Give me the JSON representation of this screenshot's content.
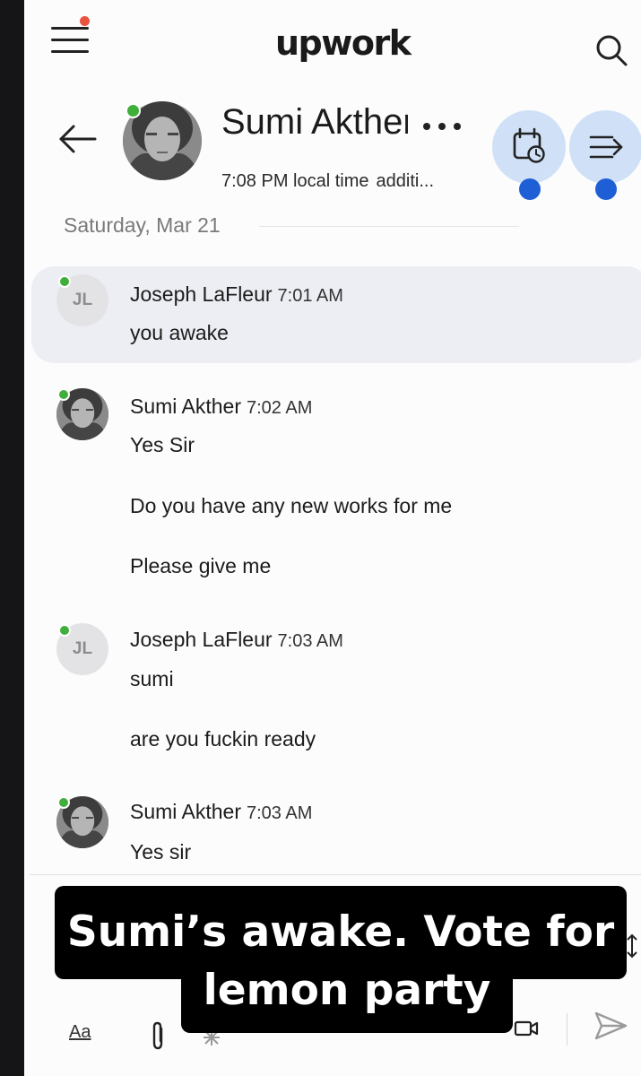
{
  "app": {
    "brand": "upwork"
  },
  "header": {
    "name": "Sumi Akther",
    "local_time": "7:08 PM local time",
    "extra": "additi..."
  },
  "date_divider": "Saturday, Mar 21",
  "messages": [
    {
      "sender": "Joseph LaFleur",
      "initials": "JL",
      "time": "7:01 AM",
      "lines": [
        "you awake"
      ],
      "highlighted": true
    },
    {
      "sender": "Sumi Akther",
      "time": "7:02 AM",
      "lines": [
        "Yes Sir",
        "Do you have any new works for me",
        "Please give me"
      ]
    },
    {
      "sender": "Joseph LaFleur",
      "initials": "JL",
      "time": "7:03 AM",
      "lines": [
        "sumi",
        "are you fuckin ready"
      ]
    },
    {
      "sender": "Sumi Akther",
      "time": "7:03 AM",
      "lines": [
        "Yes sir"
      ]
    }
  ],
  "composer": {
    "format_label": "Aa"
  },
  "caption": {
    "line1": "Sumi’s awake. Vote for",
    "line2": "lemon party"
  },
  "colors": {
    "online": "#3fae3b",
    "notification": "#e9543f",
    "action_button": "#cfe0f7",
    "action_dot": "#1f5fd6",
    "highlight": "#eceef3"
  },
  "icons": [
    "menu-icon",
    "search-icon",
    "back-arrow-icon",
    "more-icon",
    "calendar-clock-icon",
    "forward-icon",
    "attach-icon",
    "video-icon",
    "send-icon",
    "resize-icon"
  ]
}
